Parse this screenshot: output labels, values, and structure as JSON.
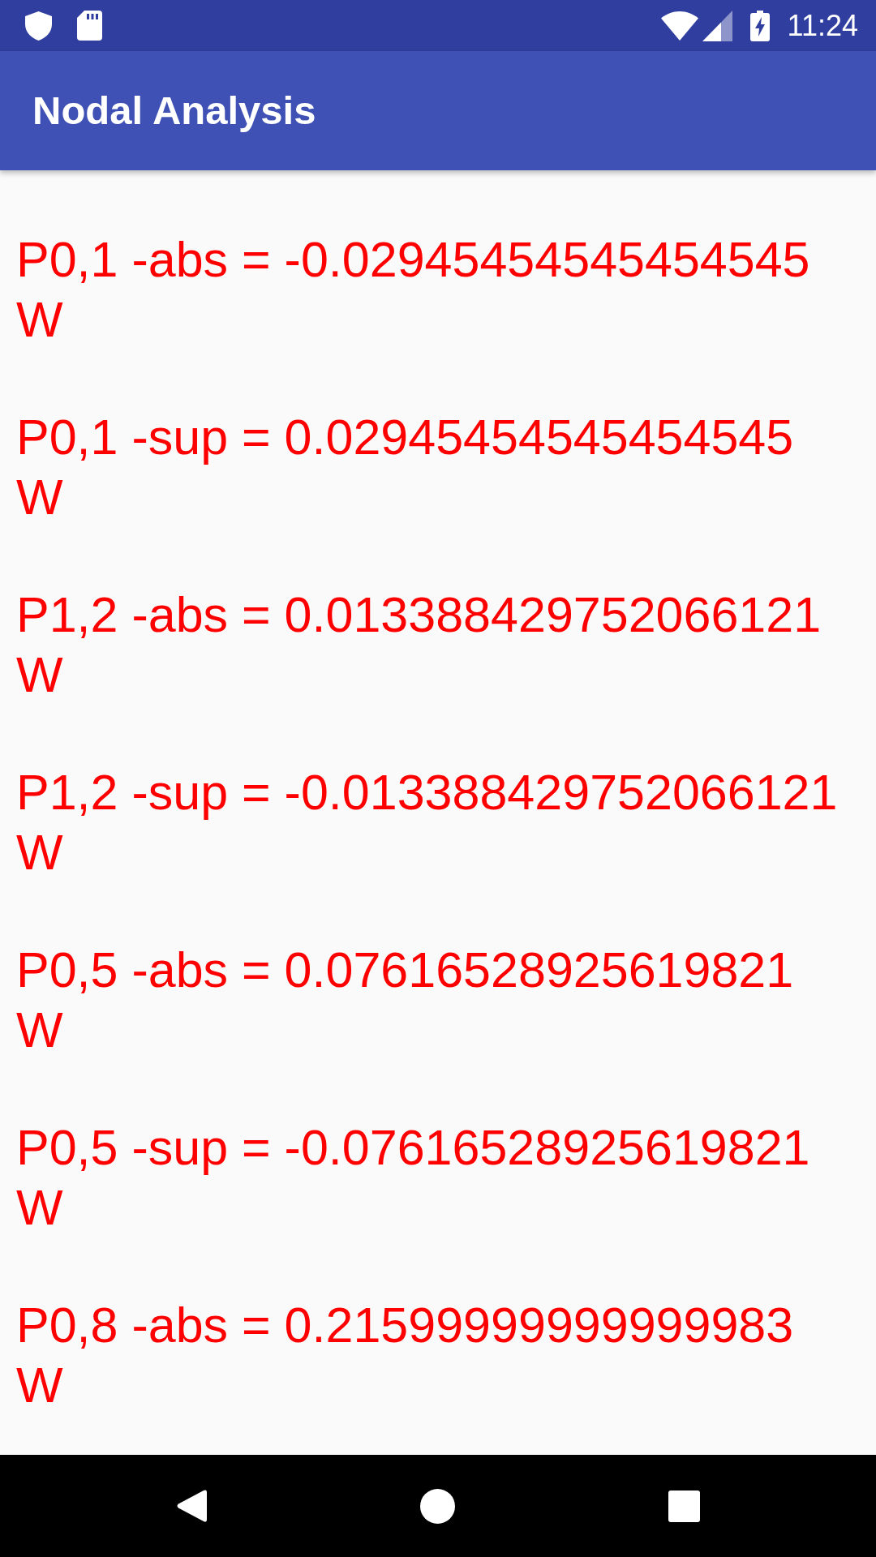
{
  "status_bar": {
    "time": "11:24"
  },
  "app_bar": {
    "title": "Nodal Analysis"
  },
  "results": [
    {
      "expression": "P0,1 -abs = -0.02945454545454545",
      "unit": "W"
    },
    {
      "expression": "P0,1 -sup = 0.02945454545454545",
      "unit": "W"
    },
    {
      "expression": "P1,2 -abs = 0.013388429752066121",
      "unit": "W"
    },
    {
      "expression": "P1,2 -sup = -0.013388429752066121",
      "unit": "W"
    },
    {
      "expression": "P0,5 -abs = 0.07616528925619821",
      "unit": "W"
    },
    {
      "expression": "P0,5 -sup = -0.07616528925619821",
      "unit": "W"
    },
    {
      "expression": "P0,8 -abs = 0.21599999999999983",
      "unit": "W"
    }
  ]
}
